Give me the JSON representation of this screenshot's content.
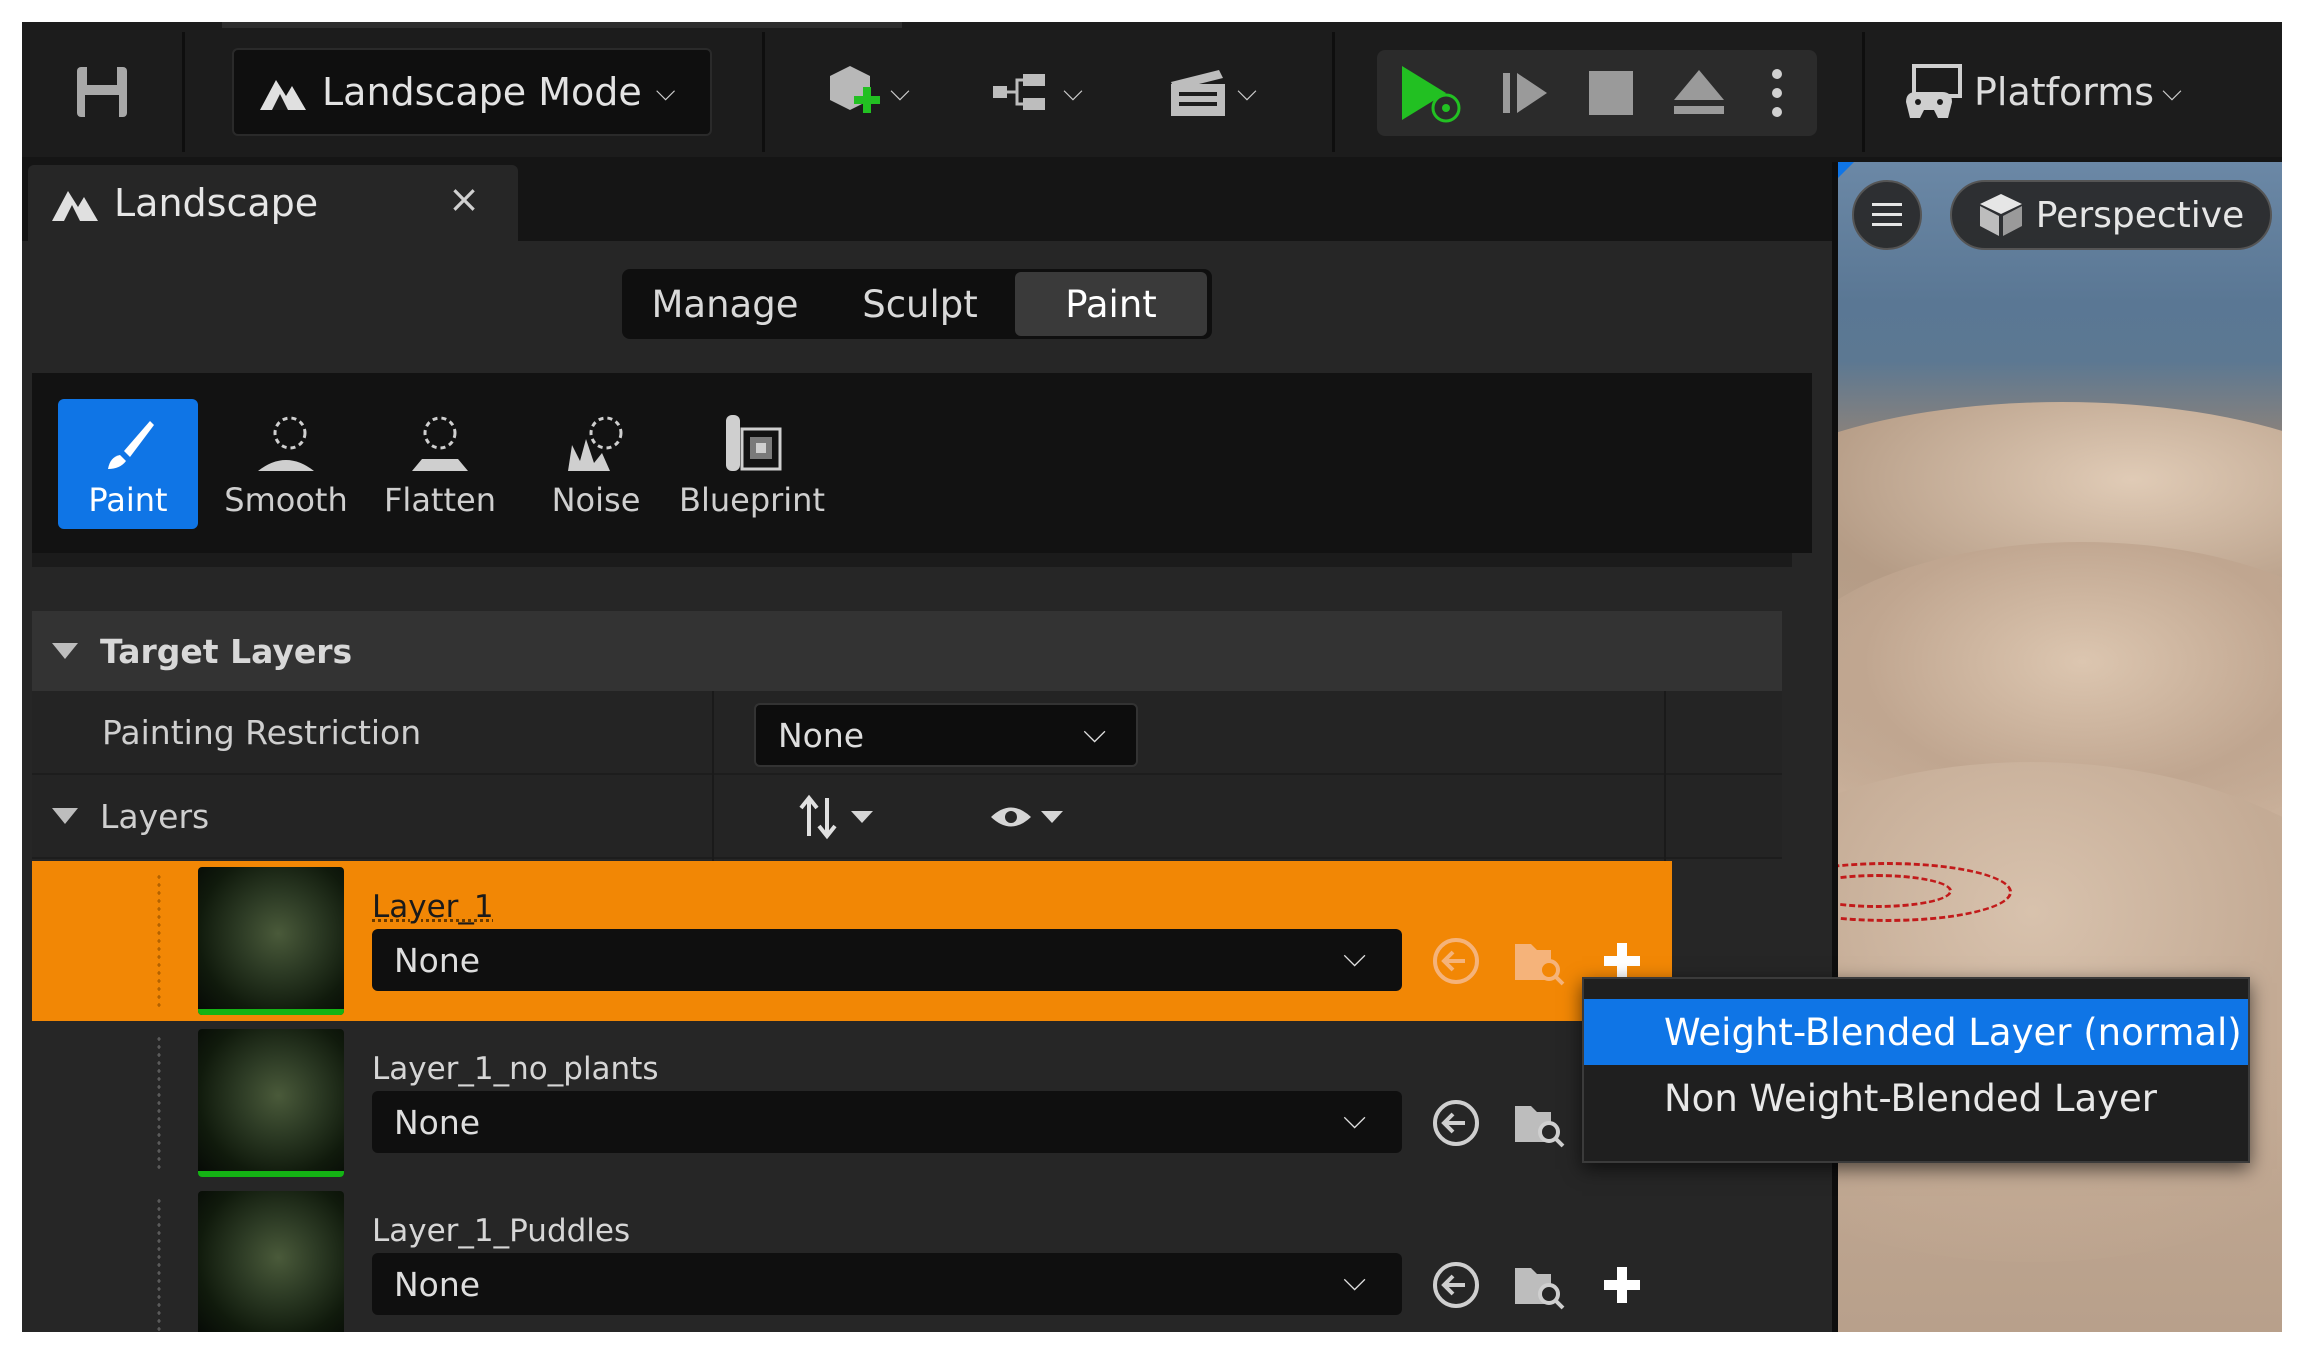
{
  "toolbar": {
    "mode_label": "Landscape Mode",
    "platforms_label": "Platforms",
    "icons": [
      "save-icon",
      "landscape-mode-icon",
      "add-content-icon",
      "blueprint-icon",
      "cinematics-icon",
      "play-icon",
      "step-icon",
      "stop-icon",
      "eject-icon",
      "more-options-icon",
      "platforms-icon"
    ],
    "play_color": "#22c022"
  },
  "tab": {
    "title": "Landscape",
    "close": "×"
  },
  "modes": [
    "Manage",
    "Sculpt",
    "Paint"
  ],
  "active_mode": "Paint",
  "tools": [
    {
      "label": "Paint",
      "active": true
    },
    {
      "label": "Smooth",
      "active": false
    },
    {
      "label": "Flatten",
      "active": false
    },
    {
      "label": "Noise",
      "active": false
    },
    {
      "label": "Blueprint",
      "active": false
    }
  ],
  "target_layers": {
    "section_title": "Target Layers",
    "painting_restriction_label": "Painting Restriction",
    "painting_restriction_value": "None",
    "layers_label": "Layers"
  },
  "layers": [
    {
      "name": "Layer_1",
      "value": "None",
      "selected": true
    },
    {
      "name": "Layer_1_no_plants",
      "value": "None",
      "selected": false
    },
    {
      "name": "Layer_1_Puddles",
      "value": "None",
      "selected": false
    }
  ],
  "viewport": {
    "perspective_label": "Perspective"
  },
  "context_menu": {
    "items": [
      "Weight-Blended Layer (normal)",
      "Non Weight-Blended Layer"
    ],
    "highlighted": "Weight-Blended Layer (normal)"
  },
  "colors": {
    "accent_blue": "#0f75e6",
    "selection_orange": "#f28705",
    "layer_bar_green": "#14b314"
  }
}
